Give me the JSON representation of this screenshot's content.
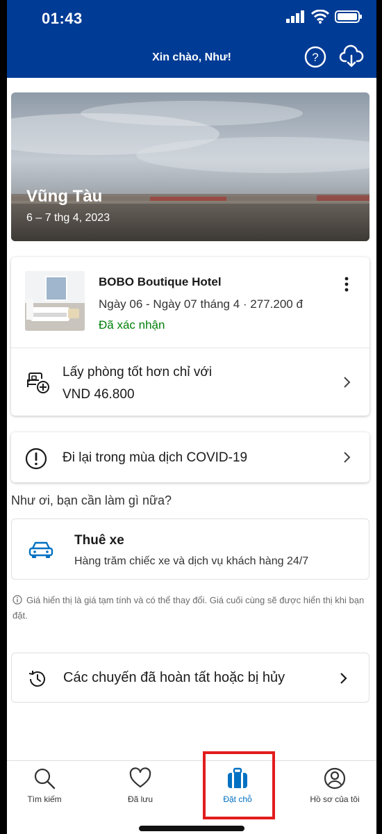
{
  "status": {
    "time": "01:43"
  },
  "header": {
    "greeting": "Xin chào, Như!"
  },
  "trip": {
    "city": "Vũng Tàu",
    "dates": "6 – 7 thg 4, 2023"
  },
  "booking": {
    "hotel_name": "BOBO Boutique Hotel",
    "info": "Ngày 06 - Ngày 07 tháng 4 · 277.200 đ",
    "status": "Đã xác nhận"
  },
  "upgrade": {
    "line1": "Lấy phòng tốt hơn chỉ với",
    "line2": "VND 46.800"
  },
  "covid": {
    "label": "Đi lại trong mùa dịch COVID-19"
  },
  "question": "Như ơi, bạn cần làm gì nữa?",
  "car_rental": {
    "title": "Thuê xe",
    "subtitle": "Hàng trăm chiếc xe và dịch vụ khách hàng 24/7"
  },
  "disclaimer": "Giá hiển thị là giá tạm tính và có thể thay đổi. Giá cuối cùng sẽ được hiển thị khi bạn đặt.",
  "past_trips": {
    "label": "Các chuyến đã hoàn tất hoặc bị hủy"
  },
  "nav": {
    "items": [
      {
        "label": "Tìm kiếm",
        "icon": "search-icon"
      },
      {
        "label": "Đã lưu",
        "icon": "heart-icon"
      },
      {
        "label": "Đặt chỗ",
        "icon": "suitcase-icon"
      },
      {
        "label": "Hồ sơ của tôi",
        "icon": "profile-icon"
      }
    ],
    "active_index": 2
  },
  "colors": {
    "brand_blue": "#003b95",
    "accent_blue": "#0071c2",
    "confirmed_green": "#008009",
    "highlight_red": "#e21c1c"
  }
}
